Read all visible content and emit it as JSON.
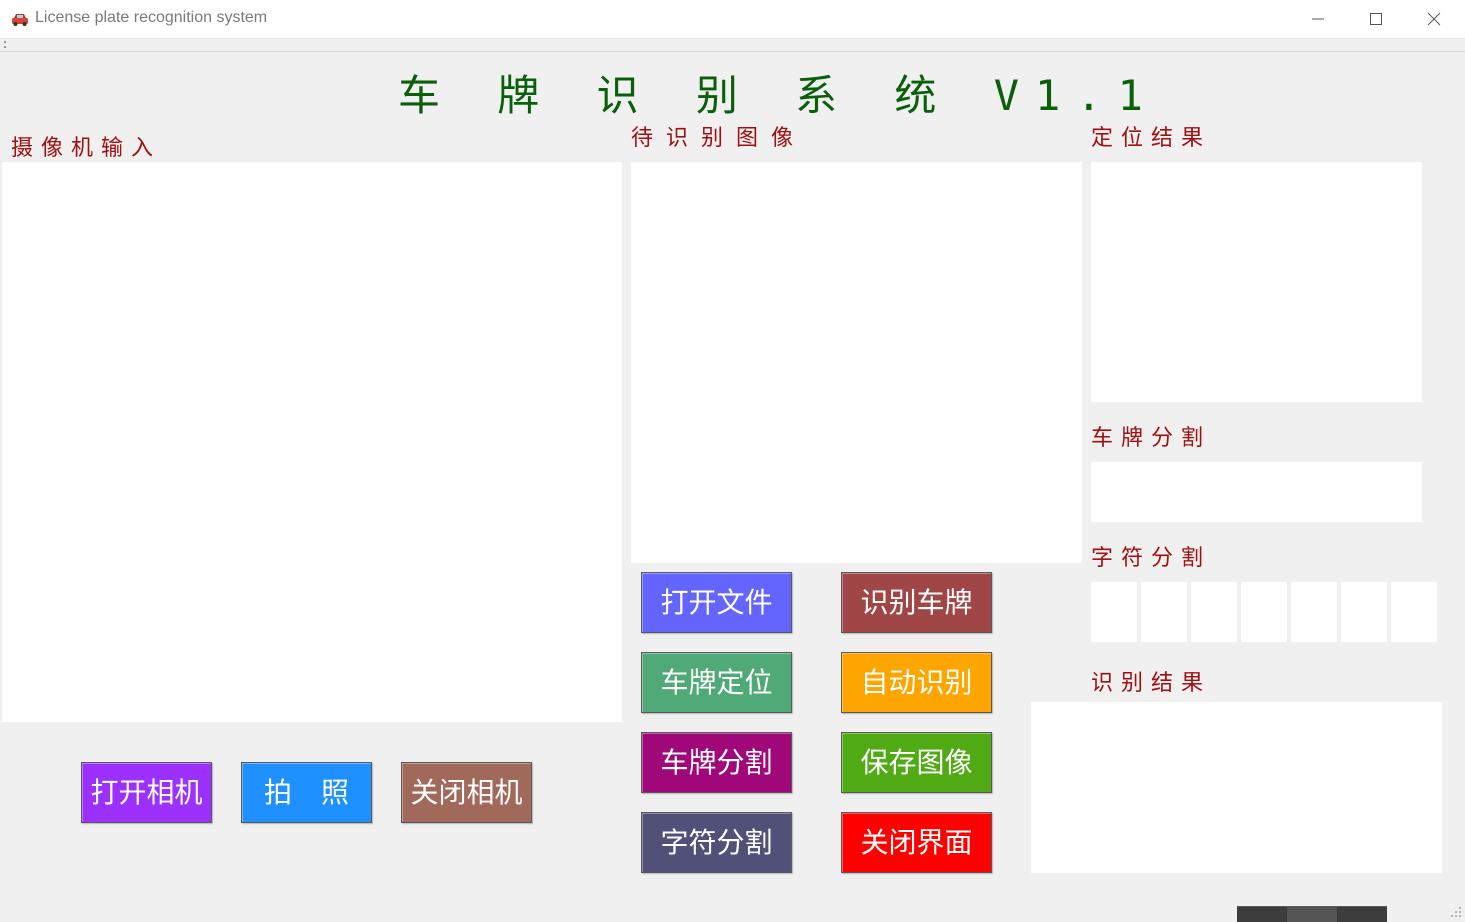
{
  "window": {
    "title": "License plate recognition system",
    "app_icon": "car-icon",
    "controls": [
      "minimize-icon",
      "maximize-icon",
      "close-icon"
    ]
  },
  "header": {
    "title": "车 牌 识 别 系 统 V1.1"
  },
  "sections": {
    "camera_input": "摄像机输入",
    "pending_image": "待识别图像",
    "locate_result": "定位结果",
    "plate_segment": "车牌分割",
    "char_segment": "字符分割",
    "recognition_result": "识别结果"
  },
  "char_slots": 7,
  "camera_buttons": {
    "open_camera": "打开相机",
    "take_photo": "拍 照",
    "close_camera": "关闭相机"
  },
  "action_buttons": {
    "open_file": "打开文件",
    "recognize_plate": "识别车牌",
    "plate_locate": "车牌定位",
    "auto_recognize": "自动识别",
    "plate_segment": "车牌分割",
    "save_image": "保存图像",
    "char_segment": "字符分割",
    "close_window": "关闭界面"
  },
  "colors": {
    "title_green": "#0a5f0a",
    "label_red": "#a01010",
    "open_camera": "#9b30ff",
    "take_photo": "#1e90ff",
    "close_camera": "#a0695a",
    "open_file": "#6464ff",
    "recognize_plate": "#a04646",
    "plate_locate": "#50aa78",
    "auto_recognize": "#ffa500",
    "plate_segment": "#a0087a",
    "save_image": "#50aa14",
    "char_segment": "#505078",
    "close_window": "#ff0000"
  }
}
